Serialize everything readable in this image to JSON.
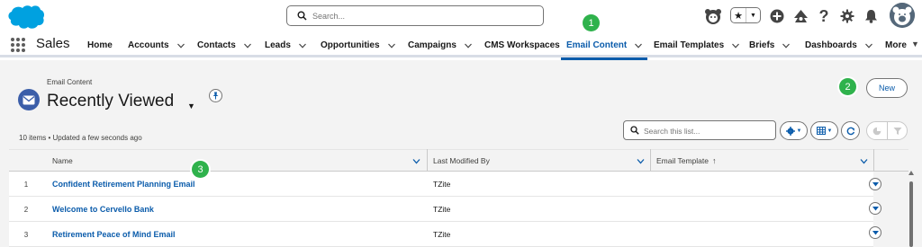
{
  "global_header": {
    "logo": "salesforce-cloud-logo",
    "search_placeholder": "Search...",
    "utility_icons": [
      "astro-icon",
      "favorites-star-icon",
      "global-actions-plus-icon",
      "trailhead-icon",
      "help-icon",
      "setup-gear-icon",
      "notifications-bell-icon",
      "user-avatar"
    ]
  },
  "nav": {
    "app_name": "Sales",
    "items": [
      {
        "label": "Home",
        "has_menu": false,
        "active": false
      },
      {
        "label": "Accounts",
        "has_menu": true,
        "active": false
      },
      {
        "label": "Contacts",
        "has_menu": true,
        "active": false
      },
      {
        "label": "Leads",
        "has_menu": true,
        "active": false
      },
      {
        "label": "Opportunities",
        "has_menu": true,
        "active": false
      },
      {
        "label": "Campaigns",
        "has_menu": true,
        "active": false
      },
      {
        "label": "CMS Workspaces",
        "has_menu": false,
        "active": false
      },
      {
        "label": "Email Content",
        "has_menu": true,
        "active": true
      },
      {
        "label": "Email Templates",
        "has_menu": true,
        "active": false
      },
      {
        "label": "Briefs",
        "has_menu": true,
        "active": false
      },
      {
        "label": "Dashboards",
        "has_menu": true,
        "active": false
      },
      {
        "label": "More",
        "has_menu": true,
        "active": false
      }
    ]
  },
  "list_header": {
    "object_label": "Email Content",
    "list_view_name": "Recently Viewed",
    "new_button": "New",
    "status": "10 items • Updated a few seconds ago",
    "search_placeholder": "Search this list..."
  },
  "table": {
    "columns": [
      {
        "label": "Name"
      },
      {
        "label": "Last Modified By"
      },
      {
        "label": "Email Template",
        "sorted": "ascending"
      }
    ],
    "rows": [
      {
        "num": "1",
        "name": "Confident Retirement Planning Email",
        "modified_by": "TZite"
      },
      {
        "num": "2",
        "name": "Welcome to Cervello Bank",
        "modified_by": "TZite"
      },
      {
        "num": "3",
        "name": "Retirement Peace of Mind Email",
        "modified_by": "TZite"
      }
    ]
  },
  "step_badges": [
    "1",
    "2",
    "3"
  ],
  "colors": {
    "brand_blue": "#0b5cab",
    "salesforce_cloud": "#00a1e0",
    "object_icon": "#3b5ea9",
    "step_badge": "#2fb24c"
  }
}
